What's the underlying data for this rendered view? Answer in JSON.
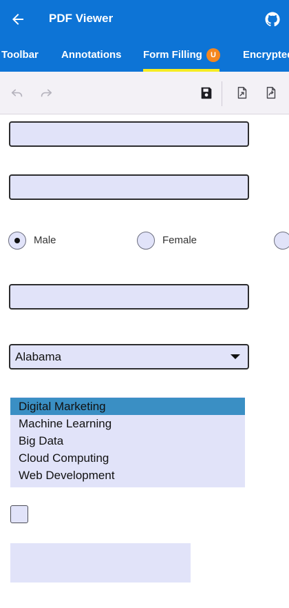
{
  "appbar": {
    "title": "PDF Viewer",
    "back_icon": "arrow-left-icon",
    "github_icon": "github-icon"
  },
  "tabs": [
    {
      "label": "Toolbar"
    },
    {
      "label": "Annotations"
    },
    {
      "label": "Form Filling",
      "badge": "U",
      "active": true
    },
    {
      "label": "Encrypted"
    }
  ],
  "toolbar": {
    "icons": [
      "undo-icon",
      "redo-icon",
      "save-icon",
      "export-icon",
      "share-export-icon"
    ]
  },
  "form": {
    "gender_options": [
      "Male",
      "Female"
    ],
    "gender_selected": "Male",
    "state_select": "Alabama",
    "listbox_items": [
      "Digital Marketing",
      "Machine Learning",
      "Big Data",
      "Cloud Computing",
      "Web Development"
    ],
    "listbox_selected": "Digital Marketing"
  },
  "colors": {
    "primary": "#0d74d6",
    "tab_indicator": "#f6ec22",
    "badge": "#f4871f",
    "field_fill": "#e1e3f9",
    "list_selection": "#3a8fc4"
  }
}
